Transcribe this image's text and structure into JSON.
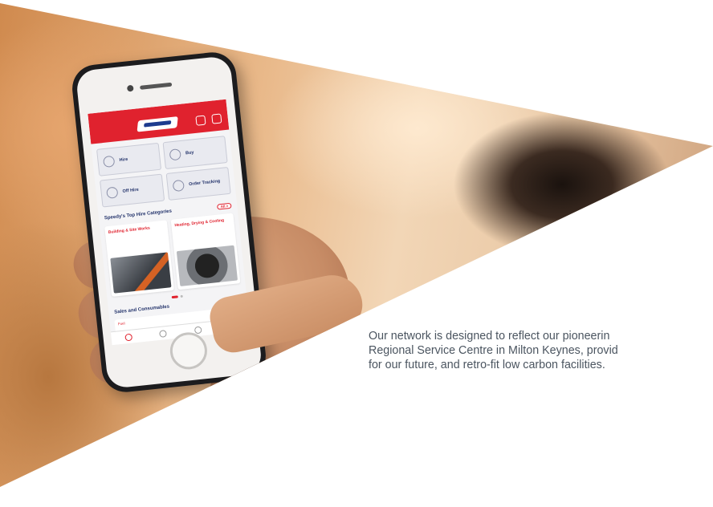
{
  "caption": {
    "line1": "Our network is designed to reflect our pioneerin",
    "line2": "Regional Service Centre in Milton Keynes, provid",
    "line3": "for our future, and retro-fit low carbon facilities."
  },
  "app": {
    "tiles": [
      "Hire",
      "Buy",
      "Off Hire",
      "Order Tracking"
    ],
    "section_title": "Speedy's Top Hire Categories",
    "section_pill": "All >",
    "cards": [
      "Building & Site Works",
      "Heating, Drying & Cooling"
    ],
    "sales_title": "Sales and Consumables",
    "mini_label": "Fuel"
  },
  "colors": {
    "brand_red": "#e0222e",
    "brand_navy": "#23336b",
    "caption_text": "#4b5560"
  }
}
